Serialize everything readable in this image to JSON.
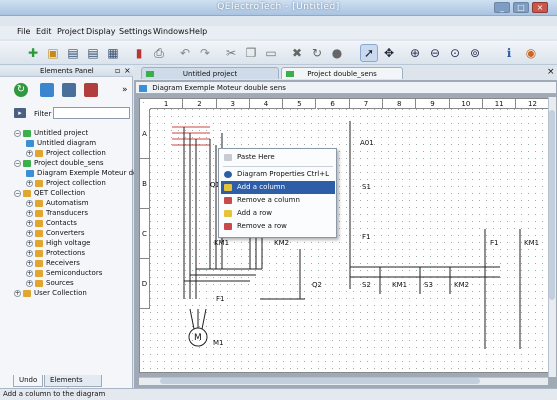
{
  "window": {
    "title": "QElectroTech - [Untitled]"
  },
  "menu": [
    "File",
    "Edit",
    "Project",
    "Display",
    "Settings",
    "Windows",
    "Help"
  ],
  "panel": {
    "title": "Elements Panel",
    "filter_label": "Filter"
  },
  "tree": [
    {
      "label": "Untitled project",
      "color": "#3bb04a"
    },
    {
      "label": "Untitled diagram",
      "color": "#3a8fd6"
    },
    {
      "label": "Project collection",
      "color": "#e0a630"
    },
    {
      "label": "Project double_sens",
      "color": "#3bb04a"
    },
    {
      "label": "Diagram Exemple Moteur double",
      "color": "#3a8fd6"
    },
    {
      "label": "Project collection",
      "color": "#e0a630"
    },
    {
      "label": "QET Collection",
      "color": "#e0a630"
    },
    {
      "label": "Automatism",
      "color": "#e0a630"
    },
    {
      "label": "Transducers",
      "color": "#e0a630"
    },
    {
      "label": "Contacts",
      "color": "#e0a630"
    },
    {
      "label": "Converters",
      "color": "#e0a630"
    },
    {
      "label": "High voltage",
      "color": "#e0a630"
    },
    {
      "label": "Protections",
      "color": "#e0a630"
    },
    {
      "label": "Receivers",
      "color": "#e0a630"
    },
    {
      "label": "Semiconductors",
      "color": "#e0a630"
    },
    {
      "label": "Sources",
      "color": "#e0a630"
    },
    {
      "label": "User Collection",
      "color": "#e0a630"
    }
  ],
  "bottom_tabs": [
    "Undo",
    "Elements Panel"
  ],
  "doc_tabs": [
    "Untitled project",
    "Project double_sens"
  ],
  "diagram_title": "Diagram Exemple Moteur double sens",
  "columns": [
    "1",
    "2",
    "3",
    "4",
    "5",
    "6",
    "7",
    "8",
    "9",
    "10",
    "11",
    "12"
  ],
  "rows": [
    "A",
    "B",
    "C",
    "D"
  ],
  "context_menu": [
    {
      "label": "Paste Here",
      "disabled": true,
      "shortcut": ""
    },
    {
      "label": "Diagram Properties",
      "disabled": false,
      "shortcut": "Ctrl+L"
    },
    {
      "label": "Add a column",
      "disabled": false,
      "shortcut": "",
      "highlighted": true
    },
    {
      "label": "Remove a column",
      "disabled": false,
      "shortcut": ""
    },
    {
      "label": "Add a row",
      "disabled": false,
      "shortcut": ""
    },
    {
      "label": "Remove a row",
      "disabled": false,
      "shortcut": ""
    }
  ],
  "diagram_labels": [
    "Q1",
    "KM1",
    "KM2",
    "F1",
    "M",
    "M1",
    "Q2",
    "A01",
    "S1",
    "F1",
    "S2",
    "KM1",
    "S3",
    "KM2",
    "F1",
    "KM1"
  ],
  "status": "Add a column to the diagram",
  "colors": {
    "accent": "#2f5ea8",
    "project_green": "#3bb04a"
  }
}
